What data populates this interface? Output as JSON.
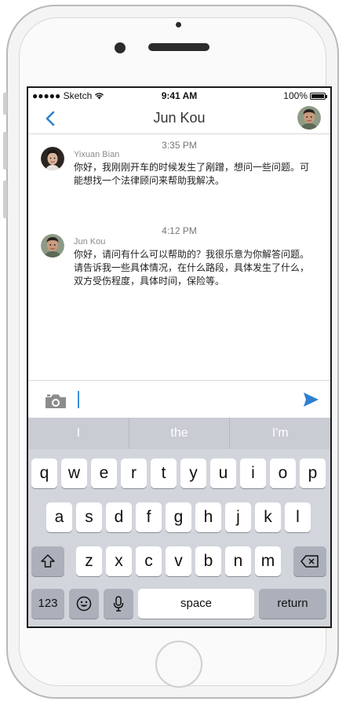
{
  "status_bar": {
    "carrier": "●●●●● Sketch",
    "wifi_icon": "wifi-icon",
    "time": "9:41 AM",
    "battery": "100%"
  },
  "nav": {
    "title": "Jun Kou",
    "back_icon": "chevron-left-icon"
  },
  "messages": [
    {
      "time": "3:35 PM",
      "sender": "Yixuan Bian",
      "text": "你好，我刚刚开车的时候发生了剐蹭，想问一些问题。可能想找一个法律顾问来帮助我解决。"
    },
    {
      "time": "4:12 PM",
      "sender": "Jun Kou",
      "text": "你好，请问有什么可以帮助的？我很乐意为你解答问题。请告诉我一些具体情况，在什么路段，具体发生了什么，双方受伤程度，具体时间，保险等。"
    }
  ],
  "input": {
    "value": "",
    "camera_icon": "camera-icon",
    "send_icon": "send-icon"
  },
  "keyboard": {
    "suggestions": [
      "I",
      "the",
      "I'm"
    ],
    "row1": [
      "q",
      "w",
      "e",
      "r",
      "t",
      "y",
      "u",
      "i",
      "o",
      "p"
    ],
    "row2": [
      "a",
      "s",
      "d",
      "f",
      "g",
      "h",
      "j",
      "k",
      "l"
    ],
    "row3": [
      "z",
      "x",
      "c",
      "v",
      "b",
      "n",
      "m"
    ],
    "numbers_label": "123",
    "space_label": "space",
    "return_label": "return"
  },
  "colors": {
    "accent": "#2f7fd0",
    "keyboard_bg": "#d2d5db"
  }
}
